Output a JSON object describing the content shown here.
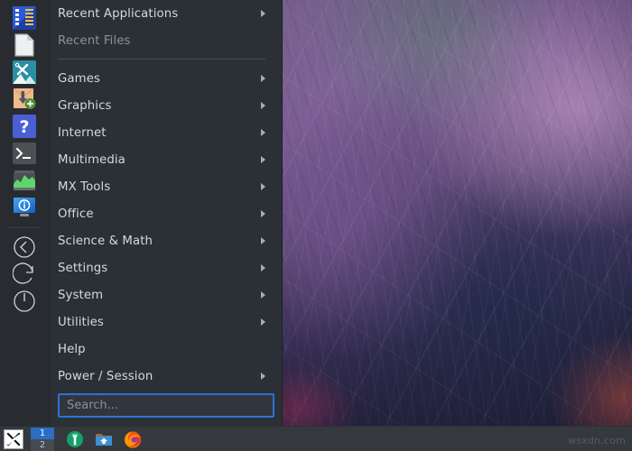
{
  "menu": {
    "sidebar_icons": [
      {
        "name": "mx-package-installer-icon",
        "label": "MX Package Installer"
      },
      {
        "name": "text-document-icon",
        "label": "Text Editor"
      },
      {
        "name": "mx-tools-icon",
        "label": "MX Tools"
      },
      {
        "name": "software-install-icon",
        "label": "Install Software"
      },
      {
        "name": "help-icon",
        "label": "Help"
      },
      {
        "name": "terminal-icon",
        "label": "Terminal"
      },
      {
        "name": "system-monitor-icon",
        "label": "System Monitor"
      },
      {
        "name": "about-display-icon",
        "label": "About"
      },
      {
        "name": "logout-icon",
        "label": "Log Out"
      },
      {
        "name": "restart-icon",
        "label": "Restart"
      },
      {
        "name": "shutdown-icon",
        "label": "Shut Down"
      }
    ],
    "items": [
      {
        "label": "Recent Applications",
        "arrow": true,
        "dim": false,
        "sep_after": false
      },
      {
        "label": "Recent Files",
        "arrow": false,
        "dim": true,
        "sep_after": true
      },
      {
        "label": "Games",
        "arrow": true,
        "dim": false,
        "sep_after": false
      },
      {
        "label": "Graphics",
        "arrow": true,
        "dim": false,
        "sep_after": false
      },
      {
        "label": "Internet",
        "arrow": true,
        "dim": false,
        "sep_after": false
      },
      {
        "label": "Multimedia",
        "arrow": true,
        "dim": false,
        "sep_after": false
      },
      {
        "label": "MX Tools",
        "arrow": true,
        "dim": false,
        "sep_after": false
      },
      {
        "label": "Office",
        "arrow": true,
        "dim": false,
        "sep_after": false
      },
      {
        "label": "Science & Math",
        "arrow": true,
        "dim": false,
        "sep_after": false
      },
      {
        "label": "Settings",
        "arrow": true,
        "dim": false,
        "sep_after": false
      },
      {
        "label": "System",
        "arrow": true,
        "dim": false,
        "sep_after": false
      },
      {
        "label": "Utilities",
        "arrow": true,
        "dim": false,
        "sep_after": false
      },
      {
        "label": "Help",
        "arrow": false,
        "dim": false,
        "sep_after": false
      },
      {
        "label": "Power / Session",
        "arrow": true,
        "dim": false,
        "sep_after": false
      }
    ],
    "search": {
      "value": "",
      "placeholder": "Search..."
    }
  },
  "taskbar": {
    "menu_button_name": "mx-menu-button",
    "workspaces": [
      {
        "label": "1",
        "active": true
      },
      {
        "label": "2",
        "active": false
      }
    ],
    "launchers": [
      {
        "name": "mx-tools-launcher-icon",
        "label": "MX Tools"
      },
      {
        "name": "file-manager-launcher-icon",
        "label": "File Manager"
      },
      {
        "name": "firefox-launcher-icon",
        "label": "Firefox"
      }
    ]
  },
  "watermark": {
    "text": "wsxdn.com"
  },
  "colors": {
    "menu_background": "#2b3036",
    "sidebar_background": "#282c31",
    "text": "#d6d8da",
    "text_dim": "#8d9296",
    "search_border": "#2a72d4",
    "taskbar_background": "#35393e",
    "workspace_active": "#2a6fc4"
  }
}
